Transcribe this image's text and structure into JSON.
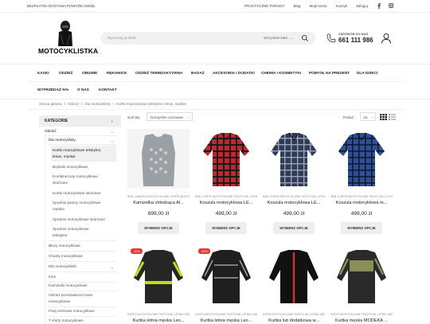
{
  "topbar": {
    "shipping": "BEZPŁATNA DOSTAWA POWYŻEJ 500ZŁ",
    "links": [
      "PRAKTYCZNE PORADY",
      "Blog",
      "Moje konto",
      "Koszyk",
      "Zaloguj"
    ],
    "social": [
      "facebook-icon",
      "instagram-icon"
    ]
  },
  "logo": {
    "text": "MOTOCYKLISTKA"
  },
  "search": {
    "placeholder": "Wyszukaj produkt",
    "category": "Wszystkie kate...",
    "chevron": "⌄"
  },
  "contact": {
    "label": "ZADZWOŃ DO NAS",
    "phone": "661 111 986"
  },
  "nav": {
    "row1": [
      "KASKI",
      "ODZIEŻ",
      "OBUWIE",
      "RĘKAWICE",
      "ODZIEŻ TERMOAKTYWNA",
      "BAGAŻ",
      "AKCESORIA I DODATKI",
      "CHEMIA I KOSMETYKI",
      "POMYSŁ NA PREZENT",
      "DLA DZIECI"
    ],
    "row2": [
      "WYPRZEDAŻ %%",
      "O NAS",
      "KONTAKT"
    ]
  },
  "breadcrumb": {
    "items": [
      "Strona główna",
      "Odzież",
      "Dla motocyklisty",
      "Kurtki motocyklowe tekstylne, letnie, męskie"
    ],
    "sep": "/"
  },
  "sidebar": {
    "header": "KATEGORIE",
    "header_chev": "⌄",
    "items": [
      {
        "label": "Odzież"
      },
      {
        "label": "Dla motocyklisty"
      },
      {
        "label": "Kurtki motocyklowe tekstylne,"
      },
      {
        "label": "letnie, męskie"
      },
      {
        "label": "Bojówki motocyklowe"
      },
      {
        "label": "Kombinezony motocyklowe"
      },
      {
        "label": "skórzane"
      },
      {
        "label": "Kurtki motocyklowe skórzane"
      },
      {
        "label": "Spodnie jeansy motocyklowe"
      },
      {
        "label": "męskie"
      },
      {
        "label": "Spodnie motocyklowe skórzane"
      },
      {
        "label": "Spodnie motocyklowe"
      },
      {
        "label": "tekstylne"
      },
      {
        "label": "Bluzy motocyklowe"
      },
      {
        "label": "Chusty motocyklowe"
      },
      {
        "label": "Dla motocyklistki"
      },
      {
        "label": "Inne"
      },
      {
        "label": "Kamizelki motocyklowe"
      },
      {
        "label": "Odzież przeciwdeszczowa"
      },
      {
        "label": "motocyklowa"
      },
      {
        "label": "Pasy nerkowe motocyklowe"
      },
      {
        "label": "T-shirty motocyklowe"
      }
    ],
    "chev": "⌄"
  },
  "toolbar": {
    "sort_label": "Sort By:",
    "sort_value": "Domyślne sortowan",
    "show_label": "Pokaż:",
    "show_value": "12",
    "chev": "⌄"
  },
  "products": [
    {
      "cat": "INNE, KAMIZELKI MOTOCYKLOWE, KURTKI MOTOCYKLOWE",
      "name": "Kamizelka chłodząca Al...",
      "price": "699,00 zł",
      "button": "WYBIERZ OPCJE",
      "colors": {
        "main": "#9aa0a3"
      }
    },
    {
      "cat": "INNE, KURTKI MOTOCYKLOWE TEKSTYLNE, LETNIE, MĘSKIE",
      "name": "Koszula motocyklowa LE...",
      "price": "499,00 zł",
      "button": "WYBIERZ OPCJE",
      "colors": {
        "main": "#c0272d"
      }
    },
    {
      "cat": "INNE, KURTKI MOTOCYKLOWE TEKSTYLNE, LETNIE, MĘSKIE",
      "name": "Koszula motocyklowa LE...",
      "price": "499,00 zł",
      "button": "WYBIERZ OPCJE",
      "colors": {
        "main": "#2f3a55"
      }
    },
    {
      "cat": "INNE, KURTKI MOTOCYKLOWE TEKSTYLNE, LETNIE, MĘSKIE",
      "name": "Koszula motocyklowa m...",
      "price": "499,00 zł",
      "button": "WYBIERZ OPCJE",
      "colors": {
        "main": "#2e4f93"
      }
    },
    {
      "badge": "-10%",
      "cat": "KURTKI MOTOCYKLOWE TEKSTYLNE, LETNIE, MĘSKIE",
      "name": "Kurtka letnia męska Leo...",
      "colors": {
        "main": "#262626",
        "accent": "#b8e011"
      }
    },
    {
      "badge": "-10%",
      "cat": "KURTKI MOTOCYKLOWE TEKSTYLNE, LETNIE, MĘSKIE",
      "name": "Kurtka letnia męska Leo...",
      "colors": {
        "main": "#1f1f1f",
        "accent": "#9aa0a6"
      }
    },
    {
      "cat": "KURTKI MOTOCYKLOWE TEKSTYLNE, LETNIE, MĘSKIE",
      "name": "Kurtka lub dodatkowa w...",
      "colors": {
        "main": "#111111",
        "accent": "#d32f2f"
      }
    },
    {
      "cat": "KURTKI MOTOCYKLOWE TEKSTYLNE, LETNIE, MĘSKIE",
      "name": "Kurtka męska MODEKA ...",
      "colors": {
        "main": "#2a2a2a",
        "accent": "#8a8f5a"
      }
    }
  ]
}
